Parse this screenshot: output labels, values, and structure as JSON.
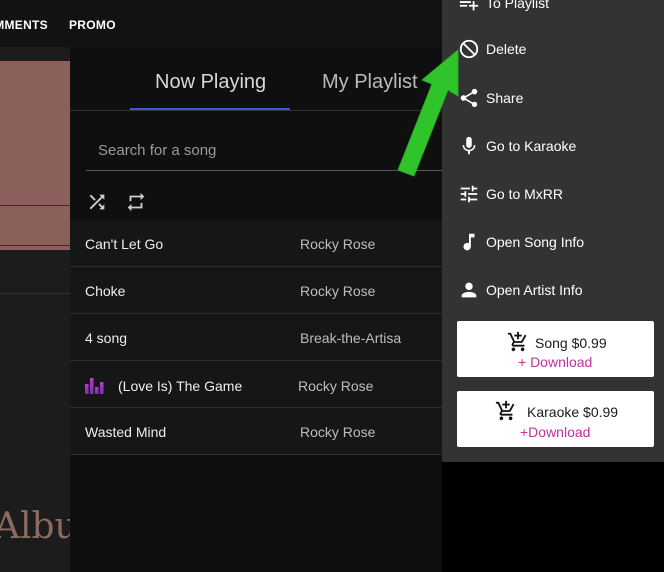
{
  "topnav": {
    "items": [
      {
        "label": "COMMENTS"
      },
      {
        "label": "PROMO"
      }
    ]
  },
  "left": {
    "albums_text": "Albums"
  },
  "tabs": [
    {
      "label": "Now Playing",
      "active": true
    },
    {
      "label": "My Playlist",
      "active": false
    }
  ],
  "search": {
    "placeholder": "Search for a song",
    "value": ""
  },
  "controls": [
    {
      "icon": "shuffle-icon"
    },
    {
      "icon": "repeat-icon"
    }
  ],
  "songs": [
    {
      "title": "Can't Let Go",
      "artist": "Rocky Rose",
      "playing": false
    },
    {
      "title": "Choke",
      "artist": "Rocky Rose",
      "playing": false
    },
    {
      "title": "4 song",
      "artist": "Break-the-Artisa",
      "playing": false
    },
    {
      "title": "(Love Is) The Game",
      "artist": "Rocky Rose",
      "playing": true
    },
    {
      "title": "Wasted Mind",
      "artist": "Rocky Rose",
      "playing": false
    }
  ],
  "menu": {
    "items": [
      {
        "label": "To Playlist",
        "icon": "playlist-add-icon"
      },
      {
        "label": "Delete",
        "icon": "block-icon"
      },
      {
        "label": "Share",
        "icon": "share-icon"
      },
      {
        "label": "Go to Karaoke",
        "icon": "mic-icon"
      },
      {
        "label": "Go to MxRR",
        "icon": "tune-icon"
      },
      {
        "label": "Open Song Info",
        "icon": "music-note-icon"
      },
      {
        "label": "Open Artist Info",
        "icon": "person-icon"
      }
    ],
    "buy": [
      {
        "title": "Song $0.99",
        "sub": "+ Download",
        "icon": "cart-add-icon"
      },
      {
        "title": "Karaoke $0.99",
        "sub": "+Download",
        "icon": "cart-add-icon"
      }
    ]
  },
  "colors": {
    "accent_tab": "#2f5fd0",
    "download_text": "#c0319a",
    "annotation_arrow": "#2fc52a",
    "menu_bg": "#333333"
  }
}
